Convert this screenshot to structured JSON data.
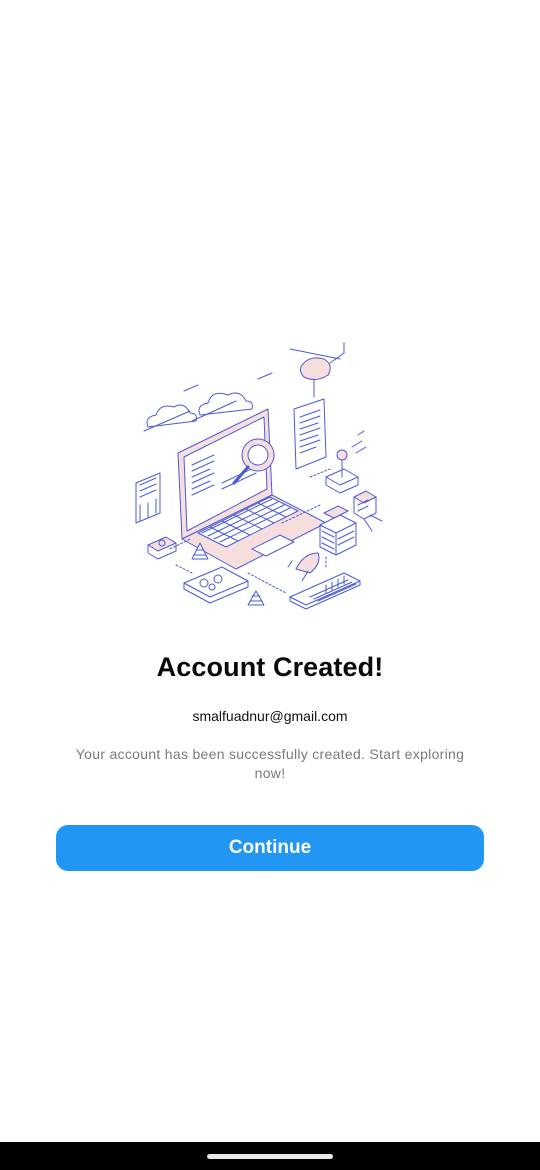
{
  "screen": {
    "title": "Account Created!",
    "email": "smalfuadnur@gmail.com",
    "message": "Your account has been successfully created. Start exploring now!",
    "continue_label": "Continue"
  },
  "illustration": {
    "icon": "laptop-network-illustration"
  },
  "colors": {
    "accent": "#2196F3",
    "title": "#0a0a0a",
    "message": "#7a7a7a",
    "illustration_line": "#4a5bd6",
    "illustration_fill": "#f7dede"
  },
  "system": {
    "nav_icon": "home-indicator"
  }
}
